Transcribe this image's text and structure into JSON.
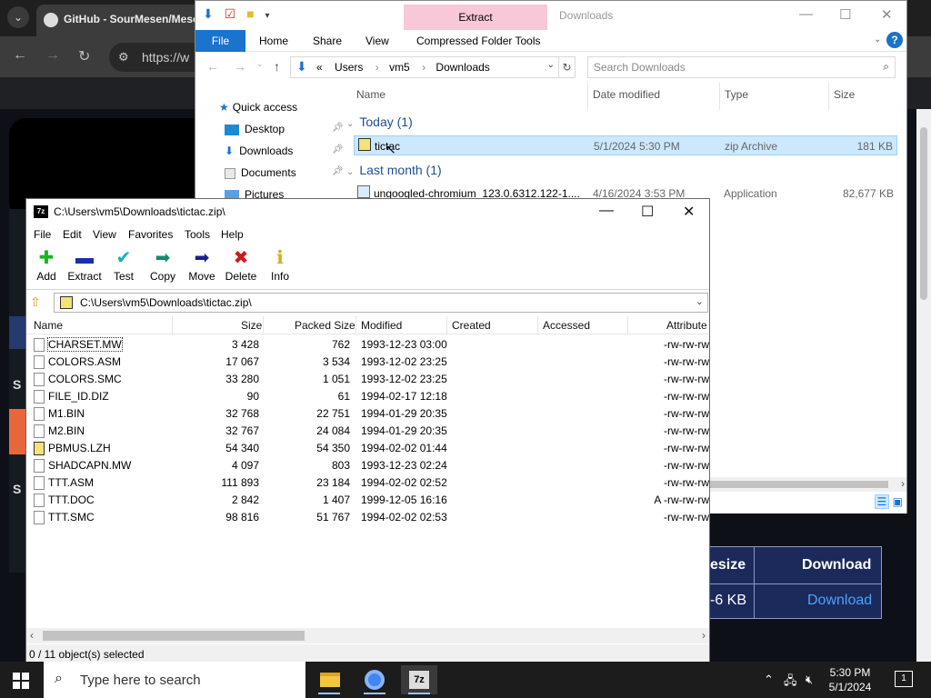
{
  "browser": {
    "tab_title": "GitHub - SourMesen/Mese",
    "url": "https://w",
    "heading_s1": "S",
    "heading_s2": "S",
    "download_table": {
      "col1_header": "esize",
      "col2_header": "Download",
      "col1_value": "-6 KB",
      "col2_value": "Download"
    }
  },
  "explorer": {
    "qat_save": "↓",
    "ribbon_context_tab": "Extract",
    "window_title": "Downloads",
    "ribbon_tabs": [
      "File",
      "Home",
      "Share",
      "View",
      "Compressed Folder Tools"
    ],
    "help": "?",
    "breadcrumb": [
      "«",
      "Users",
      "vm5",
      "Downloads"
    ],
    "search_placeholder": "Search Downloads",
    "nav": {
      "quick_access": "Quick access",
      "items": [
        "Desktop",
        "Downloads",
        "Documents",
        "Pictures"
      ]
    },
    "columns": [
      "Name",
      "Date modified",
      "Type",
      "Size"
    ],
    "groups": [
      {
        "label": "Today (1)",
        "rows": [
          {
            "name": "tictac",
            "date": "5/1/2024 5:30 PM",
            "type": "zip Archive",
            "size": "181 KB",
            "selected": true
          }
        ]
      },
      {
        "label": "Last month (1)",
        "rows": [
          {
            "name": "ungoogled-chromium_123.0.6312.122-1....",
            "date": "4/16/2024 3:53 PM",
            "type": "Application",
            "size": "82,677 KB",
            "selected": false
          }
        ]
      }
    ]
  },
  "sevenzip": {
    "window_title": "C:\\Users\\vm5\\Downloads\\tictac.zip\\",
    "menu": [
      "File",
      "Edit",
      "View",
      "Favorites",
      "Tools",
      "Help"
    ],
    "toolbar": [
      {
        "label": "Add",
        "icon": "plus-icon",
        "color": "#1db31d",
        "glyph": "✚"
      },
      {
        "label": "Extract",
        "icon": "minus-icon",
        "color": "#1a2fb0",
        "glyph": "▬"
      },
      {
        "label": "Test",
        "icon": "check-icon",
        "color": "#19b0b0",
        "glyph": "✔"
      },
      {
        "label": "Copy",
        "icon": "double-arrow-icon",
        "color": "#138a6e",
        "glyph": "➡"
      },
      {
        "label": "Move",
        "icon": "arrow-icon",
        "color": "#1a1f8c",
        "glyph": "➡"
      },
      {
        "label": "Delete",
        "icon": "x-icon",
        "color": "#d11a1a",
        "glyph": "✖"
      },
      {
        "label": "Info",
        "icon": "info-icon",
        "color": "#c9b21a",
        "glyph": "ℹ"
      }
    ],
    "path": "C:\\Users\\vm5\\Downloads\\tictac.zip\\",
    "columns": [
      "Name",
      "Size",
      "Packed Size",
      "Modified",
      "Created",
      "Accessed",
      "Attribute"
    ],
    "files": [
      {
        "name": "CHARSET.MW",
        "size": "3 428",
        "packed": "762",
        "modified": "1993-12-23 03:00",
        "attr": "-rw-rw-rw",
        "icon": "doc"
      },
      {
        "name": "COLORS.ASM",
        "size": "17 067",
        "packed": "3 534",
        "modified": "1993-12-02 23:25",
        "attr": "-rw-rw-rw",
        "icon": "doc"
      },
      {
        "name": "COLORS.SMC",
        "size": "33 280",
        "packed": "1 051",
        "modified": "1993-12-02 23:25",
        "attr": "-rw-rw-rw",
        "icon": "doc"
      },
      {
        "name": "FILE_ID.DIZ",
        "size": "90",
        "packed": "61",
        "modified": "1994-02-17 12:18",
        "attr": "-rw-rw-rw",
        "icon": "doc"
      },
      {
        "name": "M1.BIN",
        "size": "32 768",
        "packed": "22 751",
        "modified": "1994-01-29 20:35",
        "attr": "-rw-rw-rw",
        "icon": "doc"
      },
      {
        "name": "M2.BIN",
        "size": "32 767",
        "packed": "24 084",
        "modified": "1994-01-29 20:35",
        "attr": "-rw-rw-rw",
        "icon": "doc"
      },
      {
        "name": "PBMUS.LZH",
        "size": "54 340",
        "packed": "54 350",
        "modified": "1994-02-02 01:44",
        "attr": "-rw-rw-rw",
        "icon": "zip"
      },
      {
        "name": "SHADCAPN.MW",
        "size": "4 097",
        "packed": "803",
        "modified": "1993-12-23 02:24",
        "attr": "-rw-rw-rw",
        "icon": "doc"
      },
      {
        "name": "TTT.ASM",
        "size": "111 893",
        "packed": "23 184",
        "modified": "1994-02-02 02:52",
        "attr": "-rw-rw-rw",
        "icon": "doc"
      },
      {
        "name": "TTT.DOC",
        "size": "2 842",
        "packed": "1 407",
        "modified": "1999-12-05 16:16",
        "attr": "A -rw-rw-rw",
        "icon": "doc"
      },
      {
        "name": "TTT.SMC",
        "size": "98 816",
        "packed": "51 767",
        "modified": "1994-02-02 02:53",
        "attr": "-rw-rw-rw",
        "icon": "doc"
      }
    ],
    "status": "0 / 11 object(s) selected"
  },
  "taskbar": {
    "search_placeholder": "Type here to search",
    "sz_label": "7z",
    "time": "5:30 PM",
    "date": "5/1/2024",
    "notifications": "1"
  }
}
